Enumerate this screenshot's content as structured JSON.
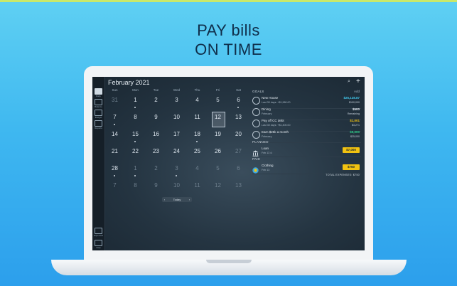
{
  "headline": {
    "line1": "PAY bills",
    "line2": "ON TIME"
  },
  "colors": {
    "bg_top": "#5fd0f3",
    "bg_bottom": "#2c9fec",
    "accent_yellow": "#f2c311",
    "positive_green": "#2ecf8a",
    "cyan": "#40c4e8",
    "gold": "#f2c311"
  },
  "sidebar": {
    "items": [
      {
        "label": "Daily",
        "icon": "calendar-icon"
      },
      {
        "label": "Balance",
        "icon": "scale-icon"
      },
      {
        "label": "Budget",
        "icon": "pie-icon"
      },
      {
        "label": "Reports",
        "icon": "chart-icon"
      },
      {
        "label": "Expenses",
        "icon": "wallet-icon"
      },
      {
        "label": "Help",
        "icon": "help-icon"
      }
    ]
  },
  "calendar": {
    "month_label": "February 2021",
    "weekdays": [
      "Sun",
      "Mon",
      "Tue",
      "Wed",
      "Thu",
      "Fri",
      "Sat"
    ],
    "weeks": [
      [
        {
          "d": "31",
          "m": true
        },
        {
          "d": "1",
          "dot": true
        },
        {
          "d": "2"
        },
        {
          "d": "3"
        },
        {
          "d": "4"
        },
        {
          "d": "5"
        },
        {
          "d": "6",
          "dot": true
        }
      ],
      [
        {
          "d": "7",
          "dot": true
        },
        {
          "d": "8"
        },
        {
          "d": "9"
        },
        {
          "d": "10"
        },
        {
          "d": "11"
        },
        {
          "d": "12",
          "sel": true
        },
        {
          "d": "13"
        }
      ],
      [
        {
          "d": "14"
        },
        {
          "d": "15",
          "dot": true
        },
        {
          "d": "16"
        },
        {
          "d": "17"
        },
        {
          "d": "18",
          "dot": true
        },
        {
          "d": "19"
        },
        {
          "d": "20"
        }
      ],
      [
        {
          "d": "21"
        },
        {
          "d": "22"
        },
        {
          "d": "23"
        },
        {
          "d": "24"
        },
        {
          "d": "25"
        },
        {
          "d": "26"
        },
        {
          "d": "27",
          "m": true
        }
      ],
      [
        {
          "d": "28",
          "dot": true
        },
        {
          "d": "1",
          "m": true,
          "dot": true
        },
        {
          "d": "2",
          "m": true
        },
        {
          "d": "3",
          "m": true,
          "dot": true
        },
        {
          "d": "4",
          "m": true
        },
        {
          "d": "5",
          "m": true
        },
        {
          "d": "6",
          "m": true
        }
      ],
      [
        {
          "d": "7",
          "m": true
        },
        {
          "d": "8",
          "m": true
        },
        {
          "d": "9",
          "m": true
        },
        {
          "d": "10",
          "m": true
        },
        {
          "d": "11",
          "m": true
        },
        {
          "d": "12",
          "m": true
        },
        {
          "d": "13",
          "m": true
        }
      ]
    ],
    "nav": {
      "prev": "‹",
      "today": "Today",
      "next": "›"
    }
  },
  "panel": {
    "search_icon": "search-icon",
    "add_icon": "+",
    "goals_label": "GOALS",
    "add_label": "Add",
    "goals": [
      {
        "name": "New House",
        "sub": "Last 30 days: +$1,980.00",
        "amount": "$25,128.87",
        "amount_color": "#40c4e8",
        "sub_amount": "$100,000"
      },
      {
        "name": "Dining",
        "sub": "February",
        "amount": "$500",
        "amount_color": "#e6edf3",
        "sub_amount": "Remaining"
      },
      {
        "name": "Pay off CC debt",
        "sub": "Last 30 days: +$1,400.00",
        "amount": "$1,001",
        "amount_color": "#f2c311",
        "sub_amount": "$3,271"
      },
      {
        "name": "Earn $25k a month",
        "sub": "February",
        "amount": "$9,000",
        "amount_color": "#2ecf8a",
        "sub_amount": "$25,000"
      }
    ],
    "planned_label": "PLANNED",
    "planned": [
      {
        "name": "Loan",
        "sub": "Feb 13 ⊙",
        "pay": "$7,000",
        "icon": "bank-icon"
      }
    ],
    "paid_label": "PAID",
    "paid": [
      {
        "name": "Clothing",
        "sub": "Feb 13",
        "pay": "$750",
        "icon": "shirt-icon"
      }
    ],
    "total": "TOTAL EXPENSES: $750"
  }
}
